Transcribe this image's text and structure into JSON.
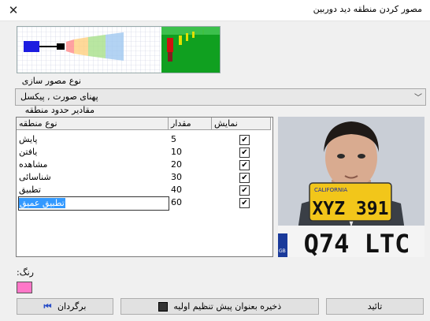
{
  "window": {
    "title": "مصور کردن منطقه دید دوربین",
    "close_glyph": "✕"
  },
  "visualization": {
    "label": "نوع مصور سازی",
    "selected": "پهنای صورت , پیکسل"
  },
  "thresholds": {
    "label": "مقادیر حدود منطقه",
    "columns": [
      "نوع منطقه",
      "مقدار",
      "نمایش"
    ],
    "rows": [
      {
        "name": "پایش",
        "value": "5",
        "show": "✔"
      },
      {
        "name": "یافتن",
        "value": "10",
        "show": "✔"
      },
      {
        "name": "مشاهده",
        "value": "20",
        "show": "✔"
      },
      {
        "name": "شناسائی",
        "value": "30",
        "show": "✔"
      },
      {
        "name": "تطبیق",
        "value": "40",
        "show": "✔"
      },
      {
        "name": "تطبیق عمیق",
        "value": "60",
        "show": "✔"
      }
    ]
  },
  "plate": {
    "state": "CALIFORNIA",
    "number": "XYZ 391",
    "front_number": "Q74 LTC",
    "gb": "GB"
  },
  "color": {
    "label": ":رنگ",
    "value": "#ff77c8"
  },
  "buttons": {
    "revert": "برگردان",
    "save_default": "ذخیره بعنوان پیش تنظیم اولیه",
    "ok": "تائید"
  }
}
